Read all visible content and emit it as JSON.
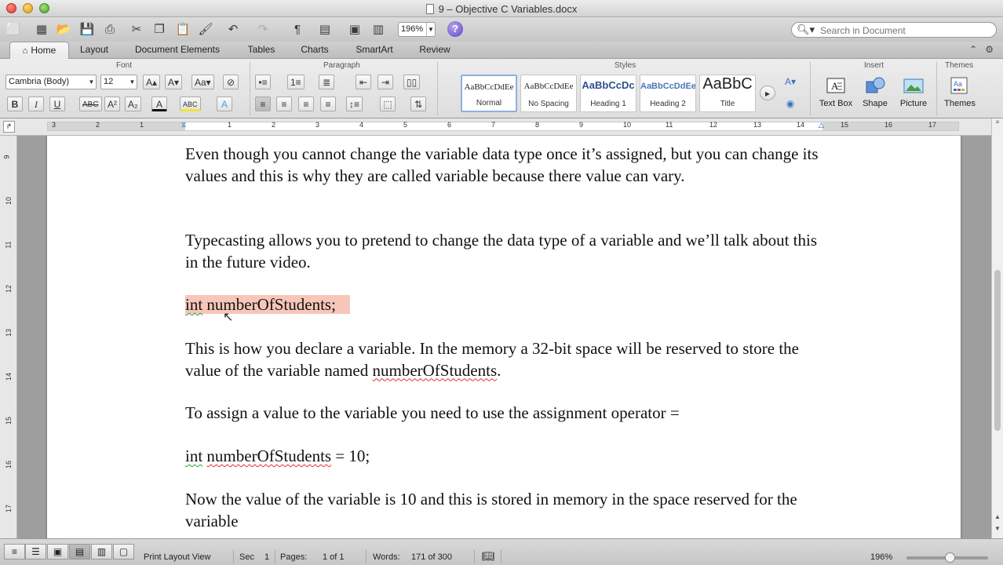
{
  "window": {
    "title": "9 – Objective C Variables.docx"
  },
  "toolbar": {
    "zoom": "196%",
    "help": "?",
    "search_placeholder": "Search in Document"
  },
  "ribbon_tabs": [
    {
      "label": "Home"
    },
    {
      "label": "Layout"
    },
    {
      "label": "Document Elements"
    },
    {
      "label": "Tables"
    },
    {
      "label": "Charts"
    },
    {
      "label": "SmartArt"
    },
    {
      "label": "Review"
    }
  ],
  "ribbon": {
    "groups": {
      "font": "Font",
      "paragraph": "Paragraph",
      "styles": "Styles",
      "insert": "Insert",
      "themes": "Themes"
    },
    "font_name": "Cambria (Body)",
    "font_size": "12",
    "styles": [
      {
        "sample": "AaBbCcDdEe",
        "name": "Normal"
      },
      {
        "sample": "AaBbCcDdEe",
        "name": "No Spacing"
      },
      {
        "sample": "AaBbCcDc",
        "name": "Heading 1"
      },
      {
        "sample": "AaBbCcDdEe",
        "name": "Heading 2"
      },
      {
        "sample": "AaBbC",
        "name": "Title"
      }
    ],
    "insert": {
      "text_box": "Text Box",
      "shape": "Shape",
      "picture": "Picture"
    },
    "themes": "Themes"
  },
  "ruler": {
    "numbers": [
      "3",
      "2",
      "1",
      "1",
      "2",
      "3",
      "4",
      "5",
      "6",
      "7",
      "8",
      "9",
      "10",
      "11",
      "12",
      "13",
      "14",
      "15",
      "16",
      "17"
    ]
  },
  "vruler": {
    "numbers": [
      "9",
      "10",
      "11",
      "12",
      "13",
      "14",
      "15",
      "16",
      "17"
    ]
  },
  "document": {
    "p1": "Even though you cannot change the variable data type once it’s assigned, but you can change its values and this is why they are called variable because there value can vary.",
    "p2": "Typecasting allows you to pretend to change the data type of a variable and we’ll talk about this in the future video.",
    "code1_kw": "int",
    "code1_var": "numberOfStudents;",
    "p3a": "This is how you declare a variable. In the memory a 32-bit space will be reserved to store the value of the variable named ",
    "p3_var": "numberOfStudents",
    "p3b": ".",
    "p4": "To assign a value to the variable you need to use the assignment operator =",
    "code2_kw": "int",
    "code2_var": "numberOfStudents",
    "code2_rest": " = 10;",
    "p5": "Now the value of the variable is 10 and this is stored in memory in the space reserved for the variable"
  },
  "status": {
    "view": "Print Layout View",
    "sec_label": "Sec",
    "sec_value": "1",
    "pages_label": "Pages:",
    "pages_value": "1 of 1",
    "words_label": "Words:",
    "words_value": "171 of 300",
    "zoom": "196%"
  }
}
